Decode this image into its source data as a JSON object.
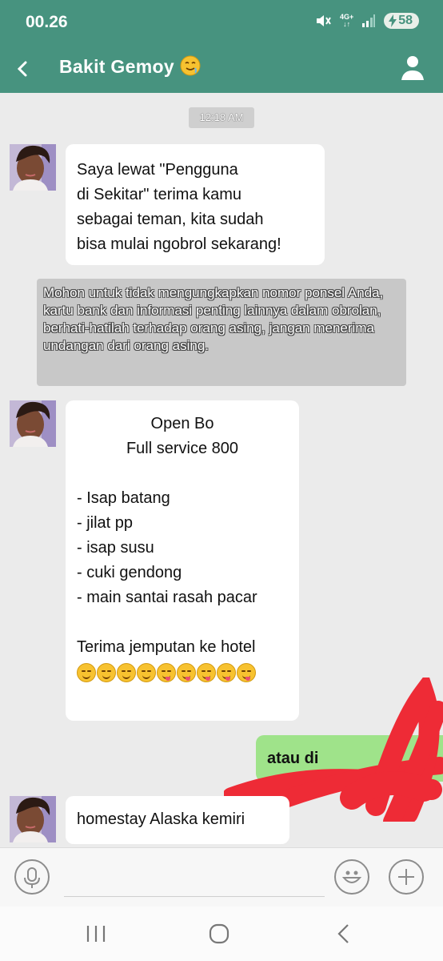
{
  "status_bar": {
    "time": "00.26",
    "network": "4G+",
    "battery": "58"
  },
  "header": {
    "title": "Bakit  Gemoy",
    "title_emoji": "drooling-face-emoji"
  },
  "chat": {
    "timestamp": "12:18 AM",
    "messages": [
      {
        "lines": [
          "Saya lewat \"Pengguna",
          "di Sekitar\" terima kamu",
          "sebagai teman, kita sudah",
          "bisa mulai ngobrol sekarang!"
        ]
      },
      {
        "centered": [
          "Open Bo",
          "Full service 800"
        ],
        "list": [
          "- Isap batang",
          "- jilat pp",
          "- isap susu",
          "- cuki gendong",
          "- main santai rasah pacar"
        ],
        "closing": "Terima jemputan ke hotel",
        "emojis": [
          "drooling",
          "drooling",
          "drooling",
          "drooling",
          "yum",
          "yum",
          "yum",
          "yum",
          "yum"
        ]
      },
      {
        "text": "homestay Alaska kemiri"
      }
    ],
    "system_notice": "Mohon untuk tidak  mengungkapkan nomor ponsel Anda, kartu bank dan informasi penting lainnya dalam obrolan, berhati-hatilah terhadap orang asing, jangan menerima undangan dari orang asing.",
    "outgoing_partial": "atau di",
    "redaction_color": "#ee2b36"
  },
  "input": {
    "placeholder": ""
  },
  "colors": {
    "header": "#47937f",
    "background": "#ebebeb",
    "outgoing_bubble": "#9fe38a"
  }
}
